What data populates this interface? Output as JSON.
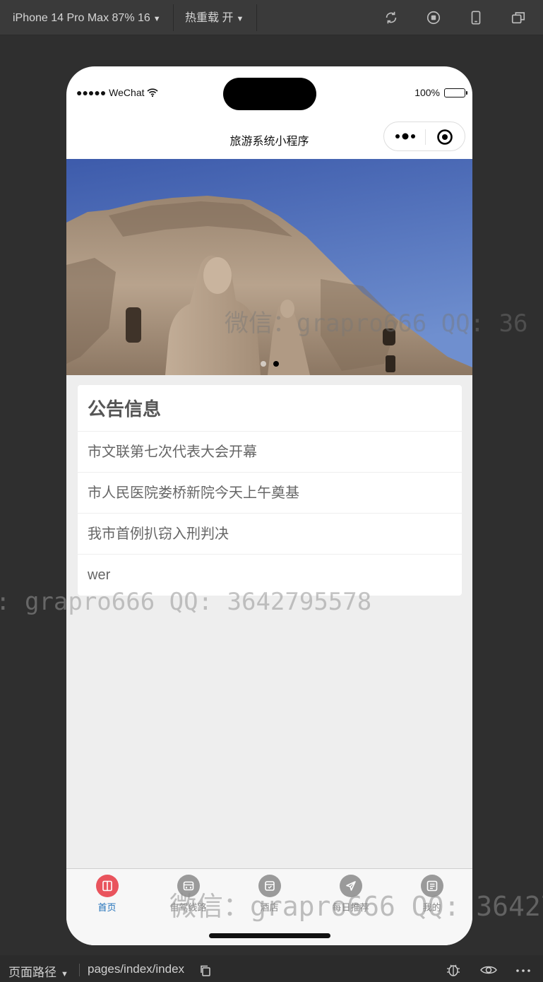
{
  "toolbar": {
    "device_label": "iPhone 14 Pro Max 87% 16",
    "hot_reload_label": "热重载 开",
    "icons": [
      "refresh-icon",
      "stop-icon",
      "phone-icon",
      "window-icon"
    ]
  },
  "status_bar": {
    "carrier": "●●●●● WeChat",
    "battery": "100%"
  },
  "navbar": {
    "title": "旅游系统小程序"
  },
  "banner": {
    "description_icon": "yungang-grottoes-buddha-photo",
    "dot_count": 2,
    "active_dot": 1
  },
  "notice": {
    "title": "公告信息",
    "items": [
      "市文联第七次代表大会开幕",
      "市人民医院娄桥新院今天上午奠基",
      "我市首例扒窃入刑判决",
      "wer"
    ]
  },
  "tabbar": {
    "tabs": [
      {
        "label": "首页",
        "icon": "book-icon"
      },
      {
        "label": "自驾线路",
        "icon": "route-icon"
      },
      {
        "label": "酒店",
        "icon": "hotel-icon"
      },
      {
        "label": "每日推荐",
        "icon": "send-icon"
      },
      {
        "label": "我的",
        "icon": "profile-icon"
      }
    ],
    "active_index": 0
  },
  "watermarks": {
    "wm1": "微信：grapro666 QQ: 36",
    "wm2": ": grapro666 QQ: 3642795578",
    "wm3": "微信：grapro666 QQ: 36427"
  },
  "bottom_bar": {
    "page_path_label": "页面路径",
    "page_path": "pages/index/index"
  },
  "colors": {
    "tab_active_icon": "#e9545d",
    "tab_active_label": "#1e6fb8",
    "content_bg": "#eeeeee"
  }
}
